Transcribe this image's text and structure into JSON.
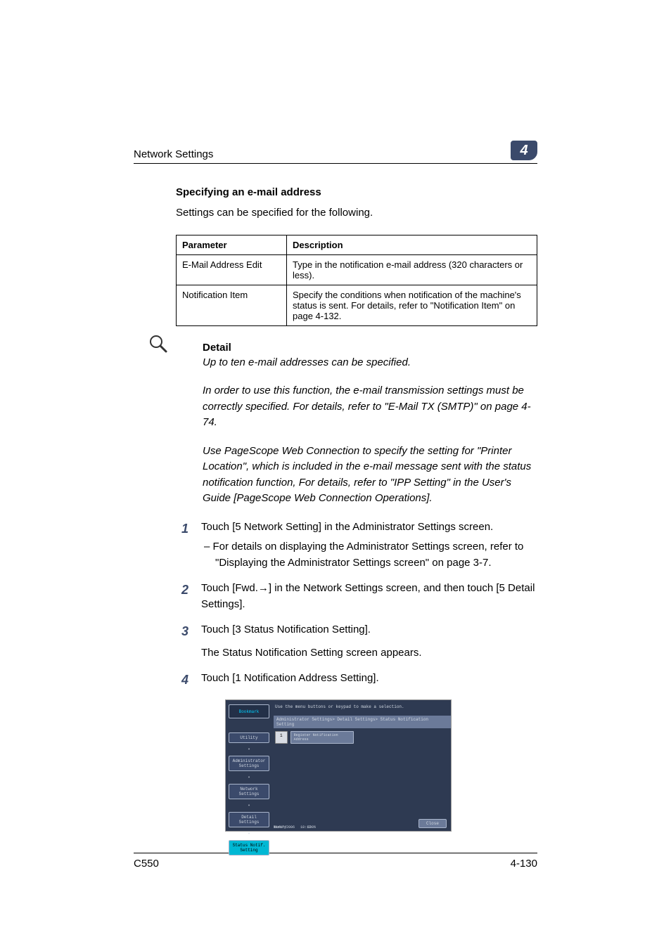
{
  "header": {
    "section": "Network Settings",
    "chapter": "4"
  },
  "section_title": "Specifying an e-mail address",
  "intro_text": "Settings can be specified for the following.",
  "table": {
    "head_param": "Parameter",
    "head_desc": "Description",
    "rows": [
      {
        "param": "E-Mail Address Edit",
        "desc": "Type in the notification e-mail address (320 characters or less)."
      },
      {
        "param": "Notification Item",
        "desc": "Specify the conditions when notification of the machine's status is sent. For details, refer to \"Notification Item\" on page 4-132."
      }
    ]
  },
  "detail": {
    "heading": "Detail",
    "p1": "Up to ten e-mail addresses can be specified.",
    "p2": "In order to use this function, the e-mail transmission settings must be correctly specified. For details, refer to \"E-Mail TX (SMTP)\" on page 4-74.",
    "p3": "Use PageScope Web Connection to specify the setting for \"Printer Location\", which is included in the e-mail message sent with the status notification function, For details, refer to \"IPP Setting\" in the User's Guide [PageScope Web Connection Operations]."
  },
  "steps": {
    "s1": {
      "text": "Touch [5 Network Setting] in the Administrator Settings screen.",
      "sub": "–   For details on displaying the Administrator Settings screen, refer to \"Displaying the Administrator Settings screen\" on page 3-7."
    },
    "s2": {
      "text": "Touch [Fwd.→] in the Network Settings screen, and then touch [5 Detail Settings]."
    },
    "s3": {
      "text": "Touch [3 Status Notification Setting].",
      "text2": "The Status Notification Setting screen appears."
    },
    "s4": {
      "text": "Touch [1 Notification Address Setting]."
    }
  },
  "screenshot": {
    "top_hint": "Use the menu buttons or keypad to make a selection.",
    "breadcrumb": "Administrator Settings> Detail Settings> Status Notification Setting",
    "bookmark": "Bookmark",
    "side": {
      "utility": "Utility",
      "admin": "Administrator\nSettings",
      "network": "Network\nSettings",
      "detail": "Detail\nSettings",
      "status": "Status Notif.\nSetting"
    },
    "sel_num": "1",
    "sel_label": "Register Notification\nAddress",
    "status_date": "11/17/2006",
    "status_time": "18:17",
    "status_mem_lbl": "Memory",
    "status_mem_val": "100%",
    "close": "Close"
  },
  "footer": {
    "model": "C550",
    "page": "4-130"
  }
}
